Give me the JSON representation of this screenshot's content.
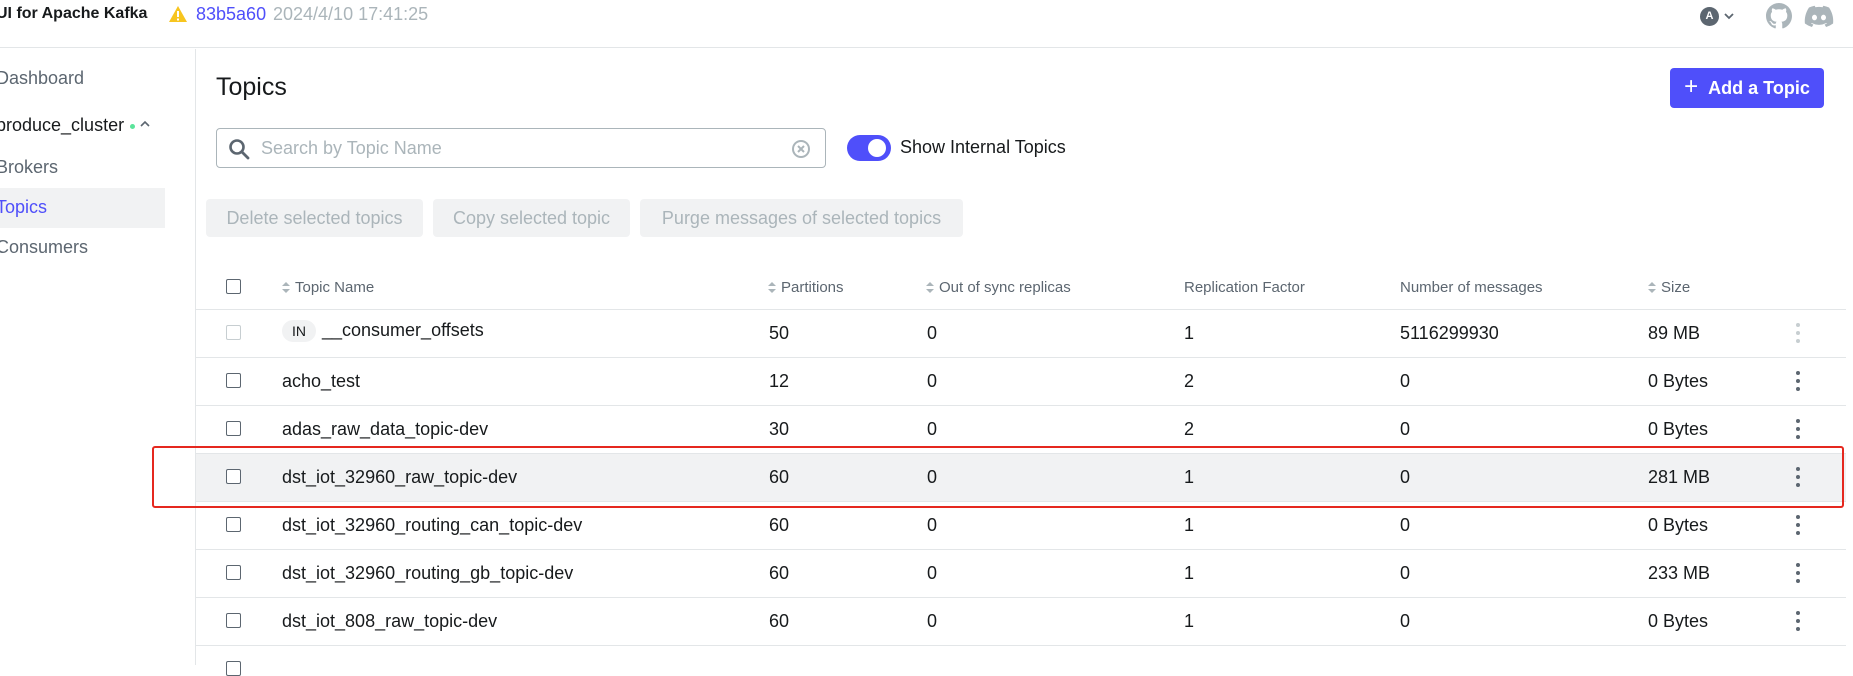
{
  "navbar": {
    "brand": "UI for Apache Kafka",
    "commit": "83b5a60",
    "build_date": "2024/4/10 17:41:25",
    "user_initial": "A"
  },
  "sidebar": {
    "dashboard": "Dashboard",
    "cluster": "produce_cluster",
    "brokers": "Brokers",
    "topics": "Topics",
    "consumers": "Consumers"
  },
  "main": {
    "title": "Topics",
    "add_button": "Add a Topic",
    "search_placeholder": "Search by Topic Name",
    "show_internal_label": "Show Internal Topics",
    "show_internal_on": true,
    "bulk_actions": [
      "Delete selected topics",
      "Copy selected topic",
      "Purge messages of selected topics"
    ]
  },
  "table": {
    "headers": {
      "topic_name": "Topic Name",
      "partitions": "Partitions",
      "out_of_sync": "Out of sync replicas",
      "replication": "Replication Factor",
      "messages": "Number of messages",
      "size": "Size"
    },
    "internal_tag": "IN",
    "rows": [
      {
        "name": "__consumer_offsets",
        "partitions": "50",
        "out_of_sync": "0",
        "replication": "1",
        "messages": "5116299930",
        "size": "89 MB",
        "internal": true
      },
      {
        "name": "acho_test",
        "partitions": "12",
        "out_of_sync": "0",
        "replication": "2",
        "messages": "0",
        "size": "0 Bytes"
      },
      {
        "name": "adas_raw_data_topic-dev",
        "partitions": "30",
        "out_of_sync": "0",
        "replication": "2",
        "messages": "0",
        "size": "0 Bytes"
      },
      {
        "name": "dst_iot_32960_raw_topic-dev",
        "partitions": "60",
        "out_of_sync": "0",
        "replication": "1",
        "messages": "0",
        "size": "281 MB",
        "highlighted": true
      },
      {
        "name": "dst_iot_32960_routing_can_topic-dev",
        "partitions": "60",
        "out_of_sync": "0",
        "replication": "1",
        "messages": "0",
        "size": "0 Bytes"
      },
      {
        "name": "dst_iot_32960_routing_gb_topic-dev",
        "partitions": "60",
        "out_of_sync": "0",
        "replication": "1",
        "messages": "0",
        "size": "233 MB"
      },
      {
        "name": "dst_iot_808_raw_topic-dev",
        "partitions": "60",
        "out_of_sync": "0",
        "replication": "1",
        "messages": "0",
        "size": "0 Bytes"
      }
    ]
  },
  "colors": {
    "accent": "#4f4ffa",
    "highlight_outline": "#e5281f",
    "status_dot": "#5be49b",
    "warning": "#f7c51f"
  }
}
